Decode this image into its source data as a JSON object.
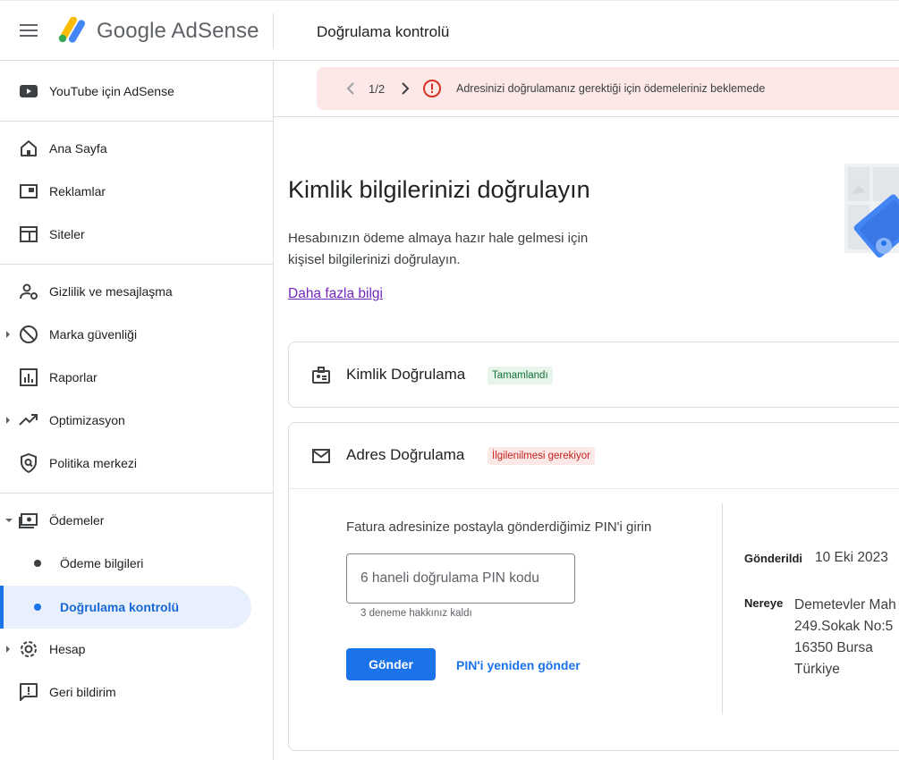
{
  "header": {
    "brand": "Google AdSense",
    "page_title": "Doğrulama kontrolü"
  },
  "sidebar": {
    "youtube": "YouTube için AdSense",
    "items": [
      {
        "label": "Ana Sayfa",
        "icon": "home-icon"
      },
      {
        "label": "Reklamlar",
        "icon": "ads-icon"
      },
      {
        "label": "Siteler",
        "icon": "sites-icon"
      },
      {
        "label": "Gizlilik ve mesajlaşma",
        "icon": "privacy-icon"
      },
      {
        "label": "Marka güvenliği",
        "icon": "block-icon"
      },
      {
        "label": "Raporlar",
        "icon": "reports-icon"
      },
      {
        "label": "Optimizasyon",
        "icon": "trending-icon"
      },
      {
        "label": "Politika merkezi",
        "icon": "policy-shield-icon"
      },
      {
        "label": "Ödemeler",
        "icon": "payments-icon"
      },
      {
        "label": "Ödeme bilgileri"
      },
      {
        "label": "Doğrulama kontrolü"
      },
      {
        "label": "Hesap",
        "icon": "gear-icon"
      },
      {
        "label": "Geri bildirim",
        "icon": "feedback-icon"
      }
    ]
  },
  "alert": {
    "count": "1/2",
    "message": "Adresinizi doğrulamanız gerektiği için ödemeleriniz beklemede"
  },
  "main": {
    "title": "Kimlik bilgilerinizi doğrulayın",
    "description": "Hesabınızın ödeme almaya hazır hale gelmesi için kişisel bilgilerinizi doğrulayın.",
    "learn_more": "Daha fazla bilgi"
  },
  "identity_card": {
    "title": "Kimlik Doğrulama",
    "status": "Tamamlandı"
  },
  "address_card": {
    "title": "Adres Doğrulama",
    "status": "İlgilenilmesi gerekiyor",
    "pin_label": "Fatura adresinize postayla gönderdiğimiz PIN'i girin",
    "pin_placeholder": "6 haneli doğrulama PIN kodu",
    "attempts": "3 deneme hakkınız kaldı",
    "send_label": "Gönder",
    "resend_label": "PIN'i yeniden gönder",
    "sent_key": "Gönderildi",
    "sent_value": "10 Eki 2023",
    "where_key": "Nereye",
    "address_lines": [
      "Demetevler Mah",
      "249.Sokak No:5",
      "16350 Bursa",
      "Türkiye"
    ]
  },
  "colors": {
    "accent": "#1a73e8",
    "alert_bg": "#fce8e6",
    "error": "#d93025",
    "success_bg": "#e6f4ea",
    "success_text": "#137333",
    "active_nav_bg": "#e8f0fe"
  }
}
